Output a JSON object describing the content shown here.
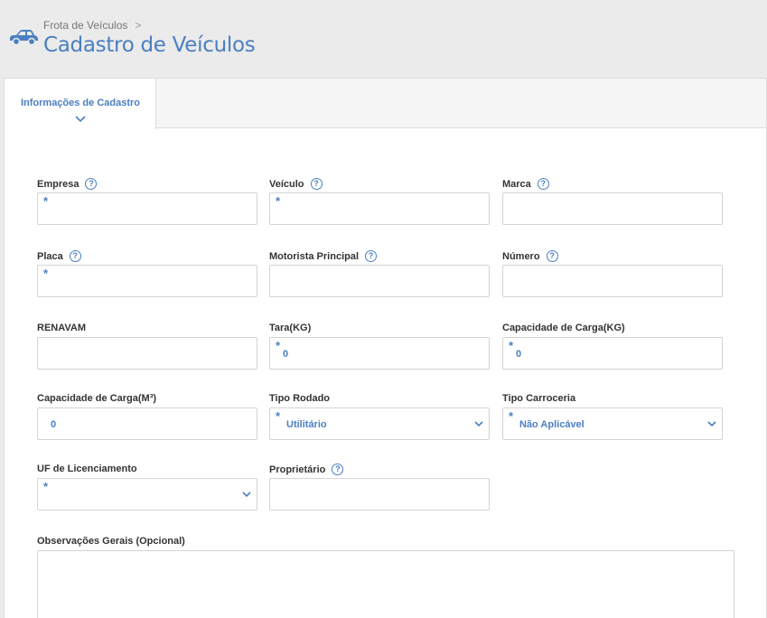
{
  "header": {
    "breadcrumb": "Frota de Veículos",
    "breadcrumb_sep": ">",
    "title": "Cadastro de Veículos",
    "icon": "car-icon"
  },
  "tabs": [
    {
      "label": "Informações de Cadastro",
      "active": true
    }
  ],
  "form": {
    "required_marker": "*",
    "help_glyph": "?",
    "empresa": {
      "label": "Empresa",
      "value": ""
    },
    "veiculo": {
      "label": "Veículo",
      "value": ""
    },
    "marca": {
      "label": "Marca",
      "value": ""
    },
    "placa": {
      "label": "Placa",
      "value": ""
    },
    "motorista": {
      "label": "Motorista Principal",
      "value": ""
    },
    "numero": {
      "label": "Número",
      "value": ""
    },
    "renavam": {
      "label": "RENAVAM",
      "value": ""
    },
    "tara": {
      "label": "Tara(KG)",
      "value": "0"
    },
    "cap_kg": {
      "label": "Capacidade de Carga(KG)",
      "value": "0"
    },
    "cap_m3": {
      "label": "Capacidade de Carga(M³)",
      "value": "0"
    },
    "tipo_rodado": {
      "label": "Tipo Rodado",
      "value": "Utilitário"
    },
    "tipo_carroceria": {
      "label": "Tipo Carroceria",
      "value": "Não Aplicável"
    },
    "uf": {
      "label": "UF de Licenciamento",
      "value": ""
    },
    "proprietario": {
      "label": "Proprietário",
      "value": ""
    },
    "observacoes": {
      "label": "Observações Gerais (Opcional)",
      "value": ""
    }
  },
  "colors": {
    "accent": "#4a7fc1",
    "background": "#ebebeb"
  }
}
